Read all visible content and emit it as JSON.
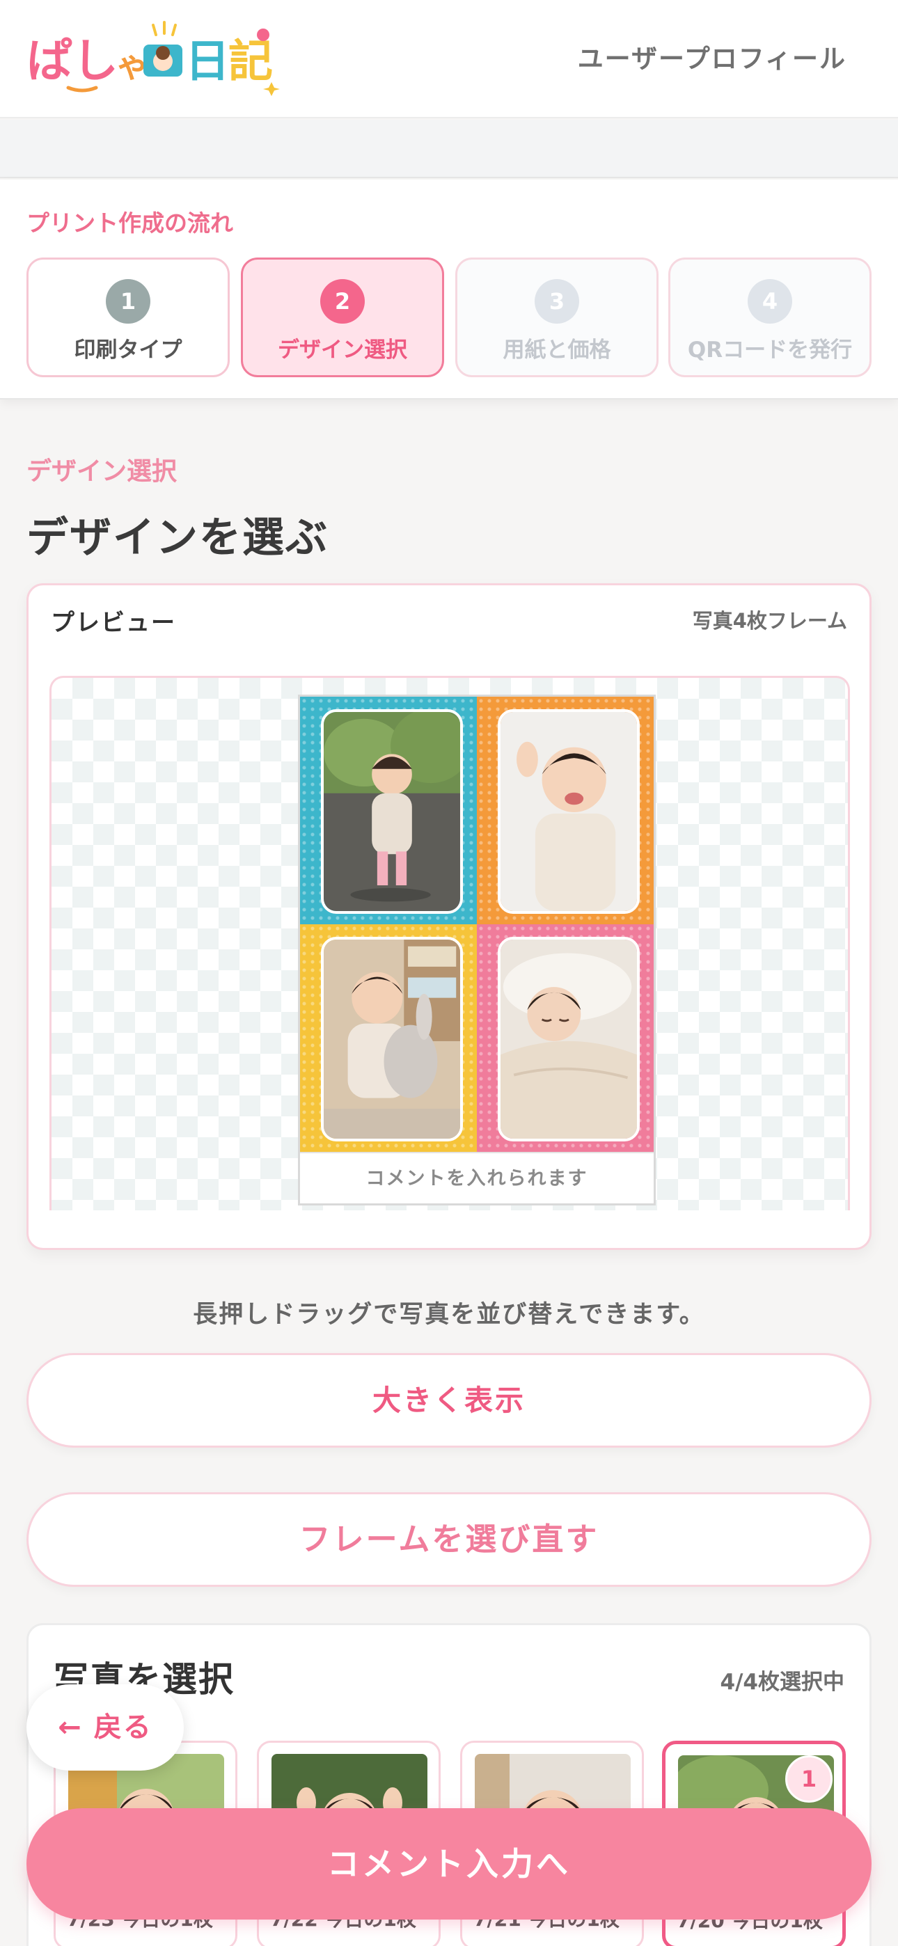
{
  "header": {
    "logo_text": "ぱしゃ日記",
    "profile_link": "ユーザープロフィール"
  },
  "steps": {
    "title": "プリント作成の流れ",
    "items": [
      {
        "num": "1",
        "label": "印刷タイプ",
        "state": "done"
      },
      {
        "num": "2",
        "label": "デザイン選択",
        "state": "active"
      },
      {
        "num": "3",
        "label": "用紙と価格",
        "state": "todo"
      },
      {
        "num": "4",
        "label": "QRコードを発行",
        "state": "todo"
      }
    ]
  },
  "design": {
    "section_label": "デザイン選択",
    "title": "デザインを選ぶ"
  },
  "preview": {
    "label": "プレビュー",
    "frame_name": "写真4枚フレーム",
    "comment_placeholder": "コメントを入れられます",
    "quadrant_colors": [
      "#3db6cb",
      "#f49a3a",
      "#f6c43a",
      "#f07c9b"
    ]
  },
  "hint": "長押しドラッグで写真を並び替えできます。",
  "buttons": {
    "enlarge": "大きく表示",
    "reselect_frame": "フレームを選び直す",
    "back": "← 戻る",
    "next": "コメント入力へ"
  },
  "photo_select": {
    "title": "写真を選択",
    "count": "4/4枚選択中",
    "thumbs": [
      {
        "caption": "7/23 今日の1枚",
        "selected": false
      },
      {
        "caption": "7/22 今日の1枚",
        "selected": false
      },
      {
        "caption": "7/21 今日の1枚",
        "selected": false
      },
      {
        "caption": "7/20 今日の1枚",
        "selected": true,
        "order": "1"
      }
    ]
  },
  "colors": {
    "accent": "#ef5a82",
    "accent_light": "#ffe2ea",
    "next_button": "#f7859f"
  }
}
